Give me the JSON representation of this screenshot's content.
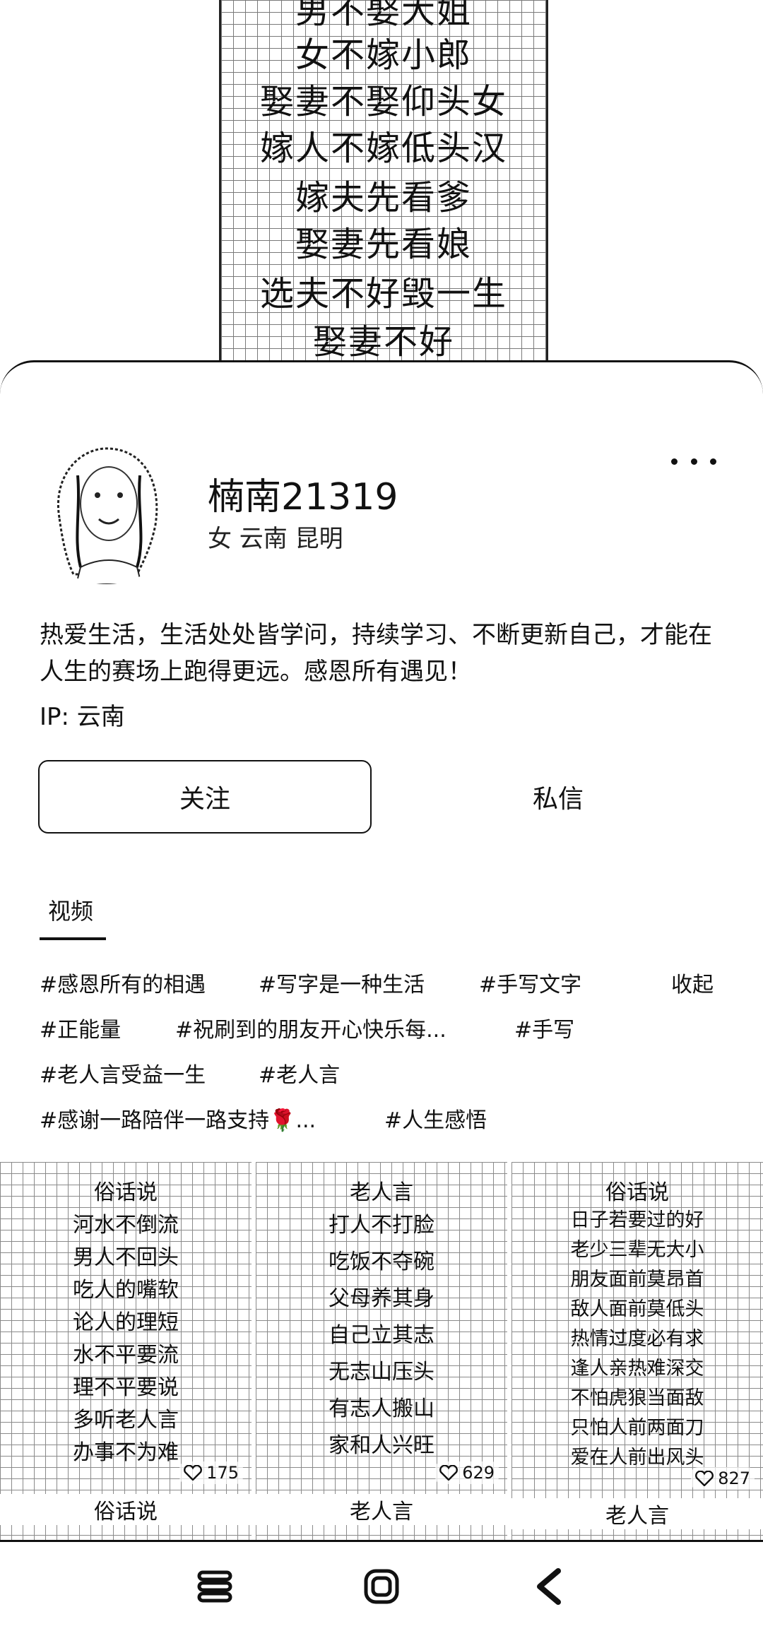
{
  "cover": {
    "lines": [
      "男不娶大姐",
      "女不嫁小郎",
      "娶妻不娶仰头女",
      "嫁人不嫁低头汉",
      "嫁夫先看爹",
      "娶妻先看娘",
      "选夫不好毁一生",
      "娶妻不好"
    ]
  },
  "profile": {
    "username": "楠南21319",
    "location": "女 云南 昆明",
    "bio": "热爱生活，生活处处皆学问，持续学习、不断更新自己，才能在人生的赛场上跑得更远。感恩所有遇见！",
    "ip": "IP: 云南",
    "follow_label": "关注",
    "message_label": "私信"
  },
  "tabs": {
    "videos": "视频"
  },
  "tags": {
    "row1": [
      "#感恩所有的相遇",
      "#写字是一种生活",
      "#手写文字"
    ],
    "collapse": "收起",
    "row2": [
      "#正能量",
      "#祝刷到的朋友开心快乐每...",
      "#手写"
    ],
    "row3": [
      "#老人言受益一生",
      "#老人言"
    ],
    "row4": [
      "#感谢一路陪伴一路支持🌹...",
      "#人生感悟"
    ]
  },
  "videos": [
    {
      "title": "俗话说",
      "lines": [
        "河水不倒流",
        "男人不回头",
        "吃人的嘴软",
        "论人的理短",
        "水不平要流",
        "理不平要说",
        "多听老人言",
        "办事不为难"
      ],
      "likes": "175",
      "bottom": "俗话说"
    },
    {
      "title": "老人言",
      "lines": [
        "打人不打脸",
        "吃饭不夺碗",
        "父母养其身",
        "自己立其志",
        "无志山压头",
        "有志人搬山",
        "家和人兴旺"
      ],
      "likes": "629",
      "bottom": "老人言"
    },
    {
      "title": "俗话说",
      "lines": [
        "日子若要过的好",
        "老少三辈无大小",
        "朋友面前莫昂首",
        "敌人面前莫低头",
        "热情过度必有求",
        "逢人亲热难深交",
        "不怕虎狼当面敌",
        "只怕人前两面刀",
        "爱在人前出风头"
      ],
      "likes": "827",
      "bottom": "老人言"
    }
  ]
}
